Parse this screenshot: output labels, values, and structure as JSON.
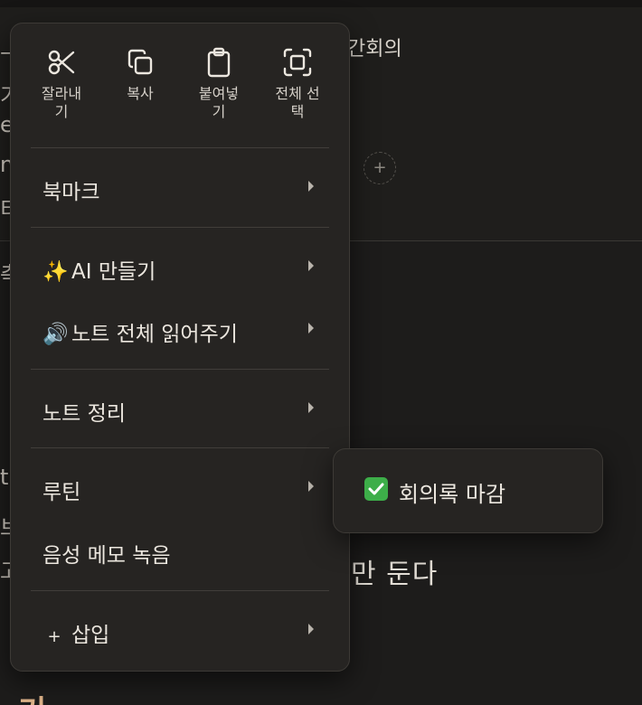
{
  "background": {
    "note_title_fragment": "간회의",
    "add_symbol": "+",
    "body_fragment": "만 둔다",
    "heading_fragment": "기",
    "left_fragments": [
      "ㅡ",
      "기",
      "e",
      "n",
      "티",
      "측",
      "t",
      "브",
      "고"
    ]
  },
  "context_menu": {
    "edit_actions": [
      {
        "label": "잘라내\n기",
        "icon": "scissors-icon"
      },
      {
        "label": "복사",
        "icon": "copy-icon"
      },
      {
        "label": "붙여넣\n기",
        "icon": "clipboard-icon"
      },
      {
        "label": "전체 선\n택",
        "icon": "select-all-icon"
      }
    ],
    "items": {
      "bookmark": "북마크",
      "ai_create": "AI 만들기",
      "ai_create_emoji": "✨",
      "read_aloud": "노트 전체 읽어주기",
      "read_aloud_emoji": "🔊",
      "organize": "노트 정리",
      "routine": "루틴",
      "voice_memo": "음성 메모 녹음",
      "insert": "삽입",
      "insert_prefix": "+"
    }
  },
  "submenu": {
    "item_label": "회의록 마감",
    "item_icon": "check-mark-button-icon",
    "check_color": "#3dae49"
  }
}
